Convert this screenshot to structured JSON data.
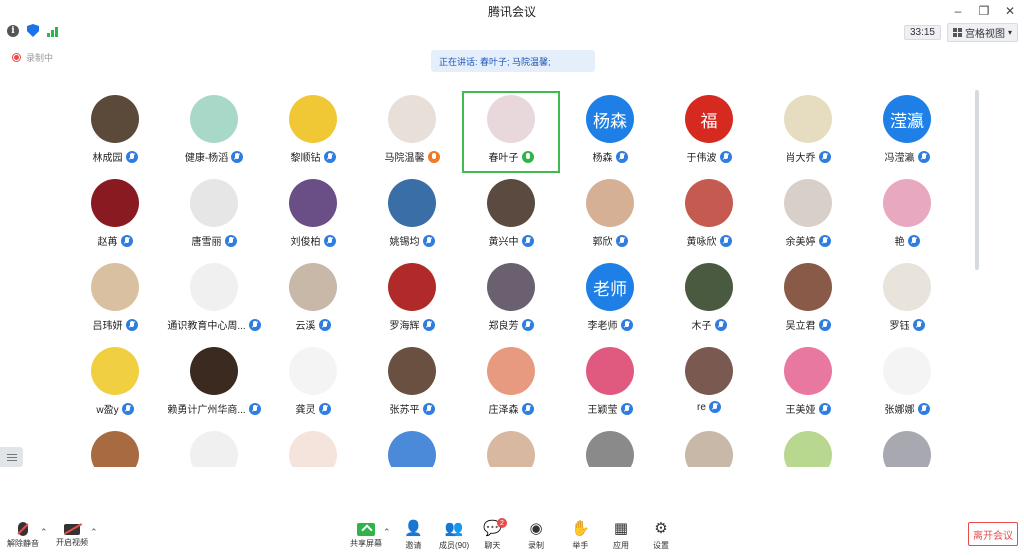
{
  "window": {
    "title": "腾讯会议"
  },
  "topbar": {
    "timer": "33:15",
    "view_mode": "宫格视图"
  },
  "recording": {
    "label": "录制中"
  },
  "speaking_banner": {
    "text": "正在讲话: 春叶子; 马院温馨;"
  },
  "participants": [
    {
      "name": "林成园",
      "avatar_color": "#5b4a3a"
    },
    {
      "name": "健康-杨滔",
      "avatar_color": "#a8d8c8"
    },
    {
      "name": "黎顺钻",
      "avatar_color": "#f0c836"
    },
    {
      "name": "马院温馨",
      "avatar_color": "#e8e0d8",
      "host": true
    },
    {
      "name": "春叶子",
      "avatar_color": "#e8d8dc",
      "active": true,
      "speaking": true
    },
    {
      "name": "杨森",
      "avatar_color": "#1e80e6",
      "avatar_text": "杨森"
    },
    {
      "name": "于伟波",
      "avatar_color": "#d62a20",
      "avatar_text": "福"
    },
    {
      "name": "肖大乔",
      "avatar_color": "#e6ddc0"
    },
    {
      "name": "冯滢瀛",
      "avatar_color": "#1e80e6",
      "avatar_text": "滢瀛"
    },
    {
      "name": "赵苒",
      "avatar_color": "#8a1a22"
    },
    {
      "name": "唐雪丽",
      "avatar_color": "#e6e6e6"
    },
    {
      "name": "刘俊柏",
      "avatar_color": "#6a4e86"
    },
    {
      "name": "姚锡均",
      "avatar_color": "#3a6ea6"
    },
    {
      "name": "黄兴中",
      "avatar_color": "#5a4a40"
    },
    {
      "name": "郭欣",
      "avatar_color": "#d6b094"
    },
    {
      "name": "黄咏欣",
      "avatar_color": "#c45a50"
    },
    {
      "name": "余美婷",
      "avatar_color": "#d8d0c8"
    },
    {
      "name": "艳",
      "avatar_color": "#e8a8c0"
    },
    {
      "name": "吕玮妍",
      "avatar_color": "#d8c0a0"
    },
    {
      "name": "通识教育中心周...",
      "avatar_color": "#f0f0f0"
    },
    {
      "name": "云溪",
      "avatar_color": "#c8b8a8"
    },
    {
      "name": "罗海辉",
      "avatar_color": "#b02a2a"
    },
    {
      "name": "郑良芳",
      "avatar_color": "#6a6070"
    },
    {
      "name": "李老师",
      "avatar_color": "#1e80e6",
      "avatar_text": "老师"
    },
    {
      "name": "木子",
      "avatar_color": "#4a5a40"
    },
    {
      "name": "吴立君",
      "avatar_color": "#8a5a48"
    },
    {
      "name": "罗钰",
      "avatar_color": "#e8e4dc"
    },
    {
      "name": "w盈y",
      "avatar_color": "#f0d040"
    },
    {
      "name": "赖勇计广州华商...",
      "avatar_color": "#3a2a20"
    },
    {
      "name": "龚灵",
      "avatar_color": "#f4f4f4"
    },
    {
      "name": "张苏平",
      "avatar_color": "#6a5040"
    },
    {
      "name": "庄泽森",
      "avatar_color": "#e89a80"
    },
    {
      "name": "王颖莹",
      "avatar_color": "#e05a80"
    },
    {
      "name": "re",
      "avatar_color": "#7a5a50"
    },
    {
      "name": "王美娅",
      "avatar_color": "#e878a0"
    },
    {
      "name": "张娜娜",
      "avatar_color": "#f4f4f4"
    },
    {
      "name": "",
      "avatar_color": "#a86a40"
    },
    {
      "name": "",
      "avatar_color": "#f0f0f0"
    },
    {
      "name": "",
      "avatar_color": "#f4e4dc"
    },
    {
      "name": "",
      "avatar_color": "#4a8ad8"
    },
    {
      "name": "",
      "avatar_color": "#d8b8a0"
    },
    {
      "name": "",
      "avatar_color": "#8a8a8a"
    },
    {
      "name": "",
      "avatar_color": "#c8b8a8"
    },
    {
      "name": "",
      "avatar_color": "#b8d890"
    },
    {
      "name": "",
      "avatar_color": "#a8a8b0"
    }
  ],
  "toolbar": {
    "unmute": "解除静音",
    "start_video": "开启视频",
    "share_screen": "共享屏幕",
    "invite": "邀请",
    "members": "成员(90)",
    "chat": "聊天",
    "chat_badge": "2",
    "record": "录制",
    "raise_hand": "举手",
    "apps": "应用",
    "settings": "设置",
    "leave": "离开会议"
  },
  "icons": {
    "info": "info-icon",
    "shield": "shield-icon",
    "signal": "signal-icon"
  }
}
